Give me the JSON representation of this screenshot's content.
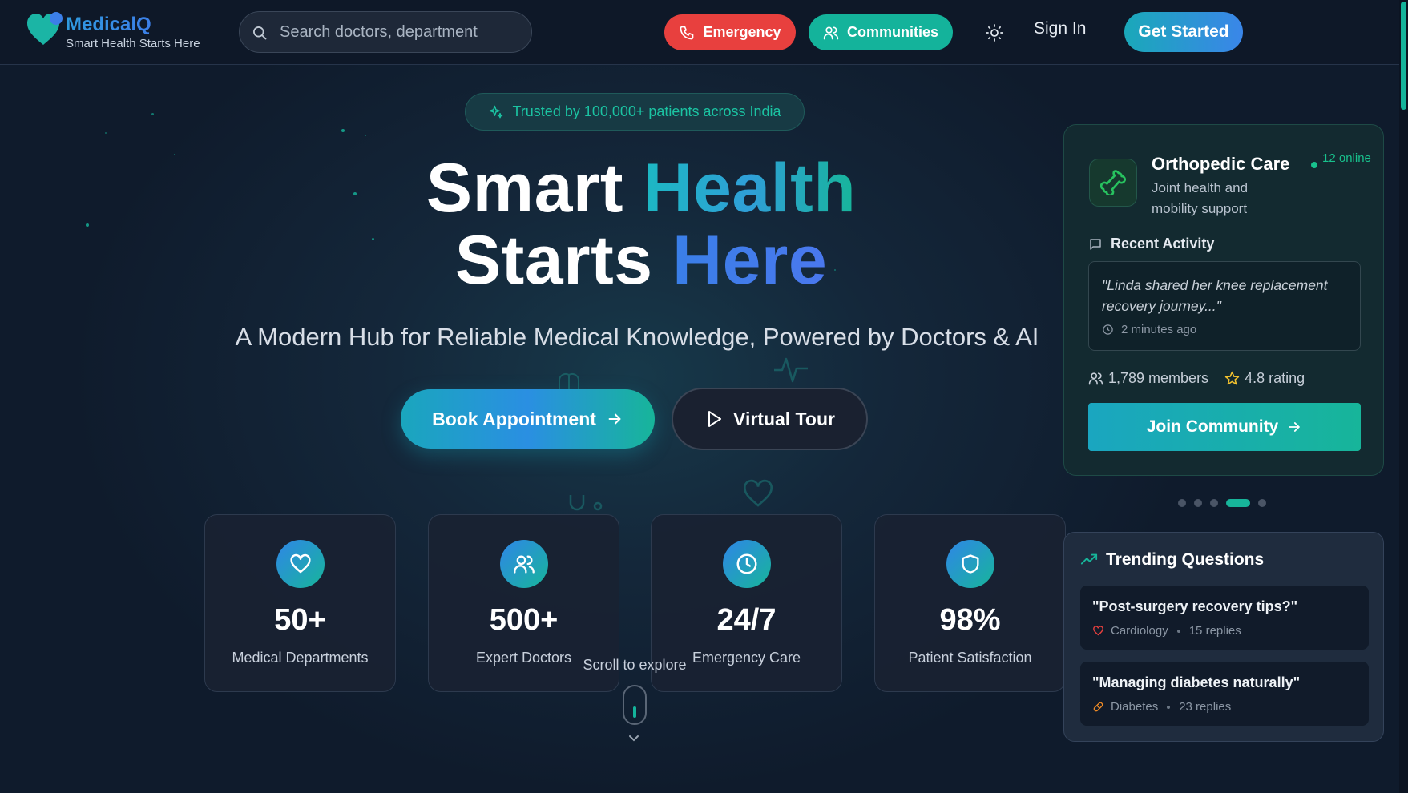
{
  "brand": {
    "name": "MedicalQ",
    "tagline": "Smart Health Starts Here"
  },
  "search": {
    "placeholder": "Search doctors, department"
  },
  "nav": {
    "emergency_label": "Emergency",
    "communities_label": "Communities",
    "signin_label": "Sign In",
    "get_started_label": "Get Started"
  },
  "hero": {
    "badge": "Trusted by 100,000+ patients across India",
    "title_line1_a": "Smart ",
    "title_line1_b": "Health",
    "title_line2_a": "Starts ",
    "title_line2_b": "Here",
    "subtitle": "A Modern Hub for Reliable Medical Knowledge, Powered by Doctors & AI",
    "book_label": "Book Appointment",
    "tour_label": "Virtual Tour"
  },
  "stats": [
    {
      "icon": "heart-icon",
      "value": "50+",
      "label": "Medical Departments"
    },
    {
      "icon": "users-icon",
      "value": "500+",
      "label": "Expert Doctors"
    },
    {
      "icon": "clock-icon",
      "value": "24/7",
      "label": "Emergency Care"
    },
    {
      "icon": "shield-icon",
      "value": "98%",
      "label": "Patient Satisfaction"
    }
  ],
  "scroll_hint": "Scroll to explore",
  "community": {
    "icon": "bone-icon",
    "title": "Orthopedic Care",
    "description": "Joint health and mobility support",
    "online": "12 online",
    "activity_heading": "Recent Activity",
    "quote": "\"Linda shared her knee replacement recovery journey...\"",
    "quote_time": "2 minutes ago",
    "members": "1,789 members",
    "rating": "4.8 rating",
    "join_label": "Join Community",
    "carousel_active_index": 3,
    "carousel_count": 5
  },
  "trending": {
    "heading": "Trending Questions",
    "questions": [
      {
        "text": "\"Post-surgery recovery tips?\"",
        "category": "Cardiology",
        "replies": "15 replies",
        "icon": "heart-icon",
        "icon_color": "#e8403e"
      },
      {
        "text": "\"Managing diabetes naturally\"",
        "category": "Diabetes",
        "replies": "23 replies",
        "icon": "pill-icon",
        "icon_color": "#f08a24"
      }
    ]
  },
  "colors": {
    "accent_teal": "#14b39b",
    "accent_blue": "#3a86e9",
    "emergency_red": "#e8403e",
    "background": "#0f1b2c"
  }
}
